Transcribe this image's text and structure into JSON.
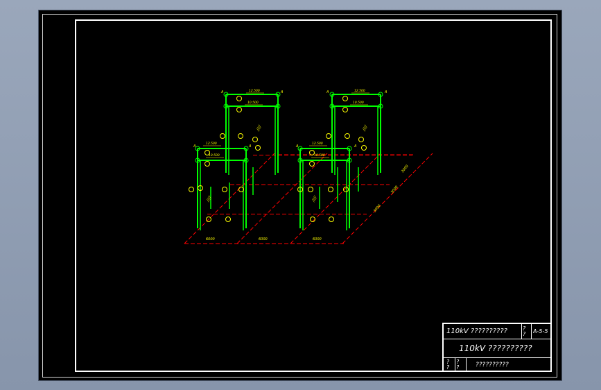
{
  "drawing": {
    "elevations": {
      "top_left": "12.500",
      "mid_left": "10.500",
      "top_right": "12.500",
      "mid_right": "10.500",
      "low_left_a": "12.500",
      "low_left_b": "10.500",
      "low_right_a": "12.500",
      "low_right_b": "10.500"
    },
    "axis_marks": [
      "A",
      "A",
      "A",
      "A",
      "A",
      "A",
      "A",
      "A"
    ],
    "dimensions": [
      "6000",
      "6000",
      "6000",
      "3000",
      "3000",
      "3000",
      "3000"
    ],
    "colors": {
      "structure": "#00ff00",
      "annotation": "#ffff00",
      "gridline": "#ff0000",
      "frame": "#ffffff",
      "background": "#000000"
    }
  },
  "title_block": {
    "project_title": "110kV ??????????",
    "sheet_code": "A-5-5",
    "sheet_code_marks": [
      "?",
      "?"
    ],
    "drawing_name": "110kV ??????????",
    "bottom_marks_left": [
      "?",
      "?"
    ],
    "bottom_marks_right": [
      "?",
      "?"
    ],
    "bottom_label": "??????????"
  }
}
